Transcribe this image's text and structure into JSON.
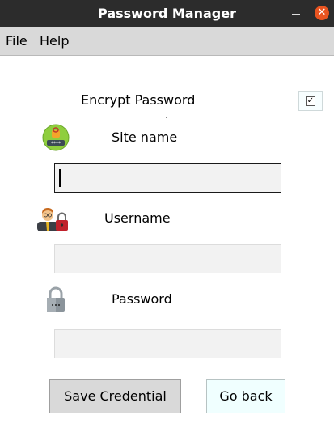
{
  "window": {
    "title": "Password Manager",
    "close_glyph": "✕"
  },
  "menu": {
    "items": [
      "File",
      "Help"
    ]
  },
  "encrypt": {
    "label": "Encrypt Password",
    "checked": true,
    "check_glyph": "✓"
  },
  "fields": {
    "site": {
      "label": "Site name",
      "icon": "site-badge-icon",
      "value": ""
    },
    "username": {
      "label": "Username",
      "icon": "user-lock-icon",
      "value": ""
    },
    "password": {
      "label": "Password",
      "icon": "padlock-icon",
      "value": ""
    }
  },
  "buttons": {
    "save": "Save Credential",
    "back": "Go back"
  },
  "colors": {
    "titlebar": "#2c2c2c",
    "close_button": "#e95420",
    "menubar": "#d9d9d9",
    "entry_bg": "#f2f2f2",
    "back_button_bg": "#f0ffff"
  }
}
